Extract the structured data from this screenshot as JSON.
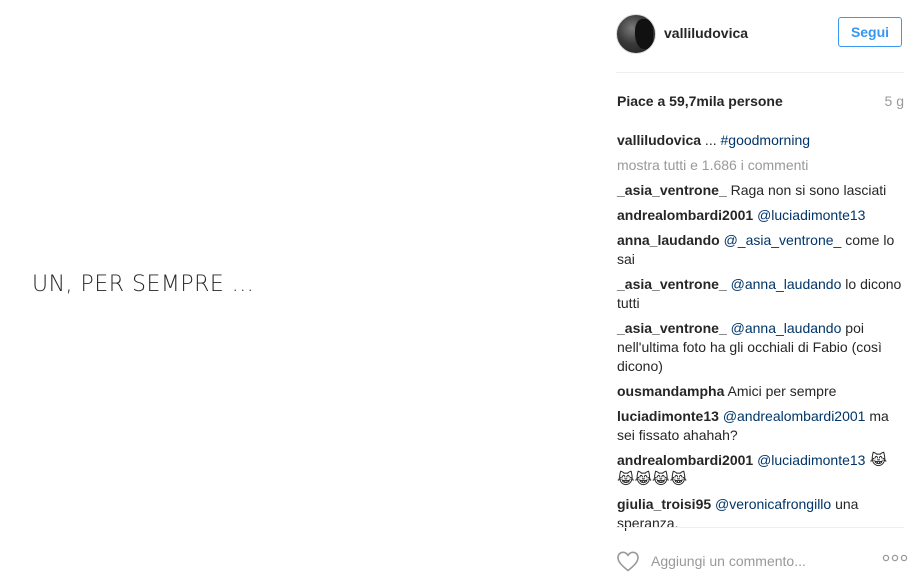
{
  "media": {
    "caption": "UN, PER SEMPRE ..."
  },
  "header": {
    "username": "valliludovica",
    "follow_label": "Segui"
  },
  "stats": {
    "likes": "Piace a 59,7mila persone",
    "age": "5 g"
  },
  "caption": {
    "user": "valliludovica",
    "text": " ... ",
    "tag": "#goodmorning"
  },
  "show_all": "mostra tutti e 1.686 i commenti",
  "comments": [
    {
      "user": "_asia_ventrone_",
      "pre": " Raga non si sono lasciati",
      "mention": "",
      "post": ""
    },
    {
      "user": "andrealombardi2001",
      "pre": " ",
      "mention": "@luciadimonte13",
      "post": ""
    },
    {
      "user": "anna_laudando",
      "pre": " ",
      "mention": "@_asia_ventrone_",
      "post": " come lo sai"
    },
    {
      "user": "_asia_ventrone_",
      "pre": " ",
      "mention": "@anna_laudando",
      "post": " lo dicono tutti"
    },
    {
      "user": "_asia_ventrone_",
      "pre": " ",
      "mention": "@anna_laudando",
      "post": " poi nell'ultima foto ha gli occhiali di Fabio (così dicono)"
    },
    {
      "user": "ousmandampha",
      "pre": " Amici per sempre",
      "mention": "",
      "post": ""
    },
    {
      "user": "luciadimonte13",
      "pre": " ",
      "mention": "@andrealombardi2001",
      "post": " ma sei fissato ahahah?"
    },
    {
      "user": "andrealombardi2001",
      "pre": " ",
      "mention": "@luciadimonte13",
      "post": " 😹 😹😹😹😹"
    },
    {
      "user": "giulia_troisi95",
      "pre": " ",
      "mention": "@veronicafrongillo",
      "post": " una speranza."
    }
  ],
  "footer": {
    "placeholder": "Aggiungi un commento..."
  },
  "icons": {
    "like": "heart-icon",
    "more": "more-options-icon"
  },
  "colors": {
    "accent": "#3897f0",
    "mention": "#003569",
    "muted": "#999999"
  }
}
